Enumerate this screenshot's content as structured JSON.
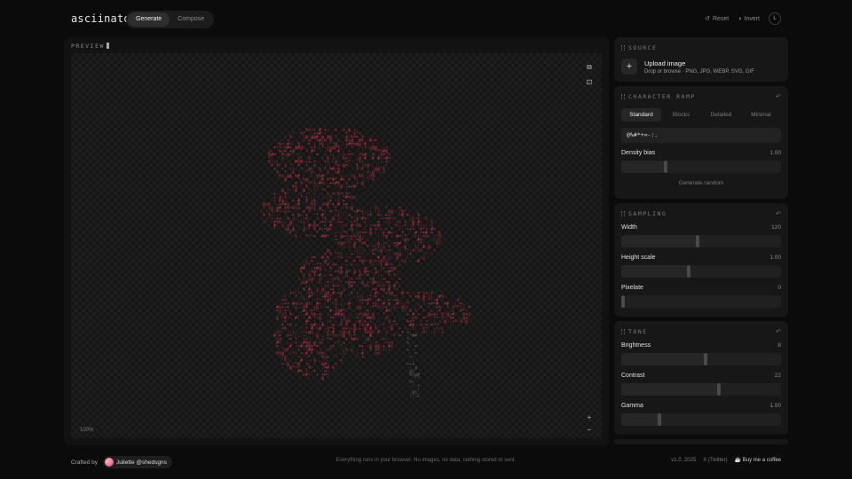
{
  "app": {
    "logo": "asciinator",
    "modes": [
      "Generate",
      "Compose"
    ],
    "active_mode": "Generate",
    "reset_label": "Reset",
    "invert_label": "Invert",
    "avatar_initial": "L"
  },
  "preview": {
    "label": "PREVIEW",
    "zoom": "100%",
    "zoom_in": "+",
    "zoom_out": "−",
    "accent_color": "#b8323f"
  },
  "source": {
    "title": "SOURCE",
    "upload_title": "Upload image",
    "upload_sub": "Drop or browse · PNG, JPG, WEBP, SVG, GIF"
  },
  "ramp": {
    "title": "CHARACTER RAMP",
    "tabs": [
      "Standard",
      "Blocks",
      "Detailed",
      "Minimal"
    ],
    "active_tab": "Standard",
    "value": "@%#*+=-:.",
    "density_label": "Density bias",
    "density_value": "1.00",
    "density_level": 0.28,
    "generate_random": "Generate random"
  },
  "sampling": {
    "title": "SAMPLING",
    "width_label": "Width",
    "width_value": "120",
    "width_level": 0.48,
    "height_label": "Height scale",
    "height_value": "1.00",
    "height_level": 0.42,
    "pixelate_label": "Pixelate",
    "pixelate_value": "0",
    "pixelate_level": 0.0
  },
  "tone": {
    "title": "TONE",
    "brightness_label": "Brightness",
    "brightness_value": "8",
    "brightness_level": 0.53,
    "contrast_label": "Contrast",
    "contrast_value": "22",
    "contrast_level": 0.61,
    "gamma_label": "Gamma",
    "gamma_value": "1.00",
    "gamma_level": 0.24
  },
  "footer": {
    "crafted_by": "Crafted by",
    "author": "Juliette @shedsgns",
    "note": "Everything runs in your browser. No images, no data, nothing stored or sent.",
    "version": "v1.0, 2025",
    "twitter": "X (Twitter)",
    "coffee": "Buy me a coffee"
  }
}
